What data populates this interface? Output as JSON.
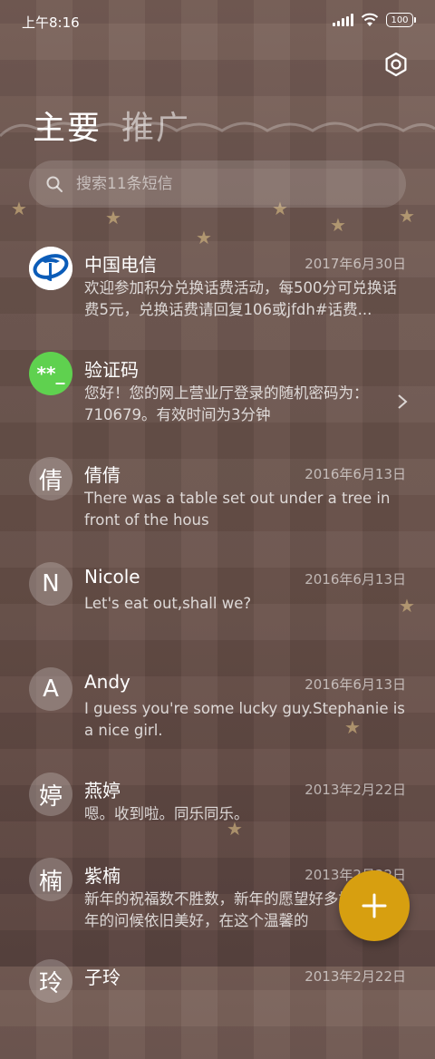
{
  "status_bar": {
    "time": "上午8:16",
    "battery": "100"
  },
  "header": {
    "tabs": [
      {
        "label": "主要"
      },
      {
        "label": "推广"
      }
    ]
  },
  "search": {
    "placeholder": "搜索11条短信"
  },
  "messages": [
    {
      "name": "中国电信",
      "date": "2017年6月30日",
      "preview": "欢迎参加积分兑换话费活动，每500分可兑换话费5元，兑换话费请回复106或jfdh#话费...",
      "avatar_icon": "china-telecom-logo-icon"
    },
    {
      "name": "验证码",
      "date": "",
      "preview": "您好！您的网上营业厅登录的随机密码为：710679。有效时间为3分钟",
      "avatar_text": "**_",
      "avatar_color": "#5fd14f"
    },
    {
      "name": "倩倩",
      "date": "2016年6月13日",
      "preview": "There was a table set out under a tree in front of the hous",
      "avatar_text": "倩"
    },
    {
      "name": "Nicole",
      "date": "2016年6月13日",
      "preview": "Let's eat out,shall we?",
      "avatar_text": "N"
    },
    {
      "name": "Andy",
      "date": "2016年6月13日",
      "preview": "I guess you're some lucky guy.Stephanie is a nice girl.",
      "avatar_text": "A"
    },
    {
      "name": "燕婷",
      "date": "2013年2月22日",
      "preview": "嗯。收到啦。同乐同乐。",
      "avatar_text": "婷"
    },
    {
      "name": "紫楠",
      "date": "2013年2月22日",
      "preview": "新年的祝福数不胜数，新年的愿望好多好多，新年的问候依旧美好，在这个温馨的",
      "avatar_text": "楠"
    },
    {
      "name": "子玲",
      "date": "2013年2月22日",
      "preview": "",
      "avatar_text": "玲"
    }
  ],
  "fab": {
    "icon": "plus-icon",
    "color": "#d79f10"
  }
}
